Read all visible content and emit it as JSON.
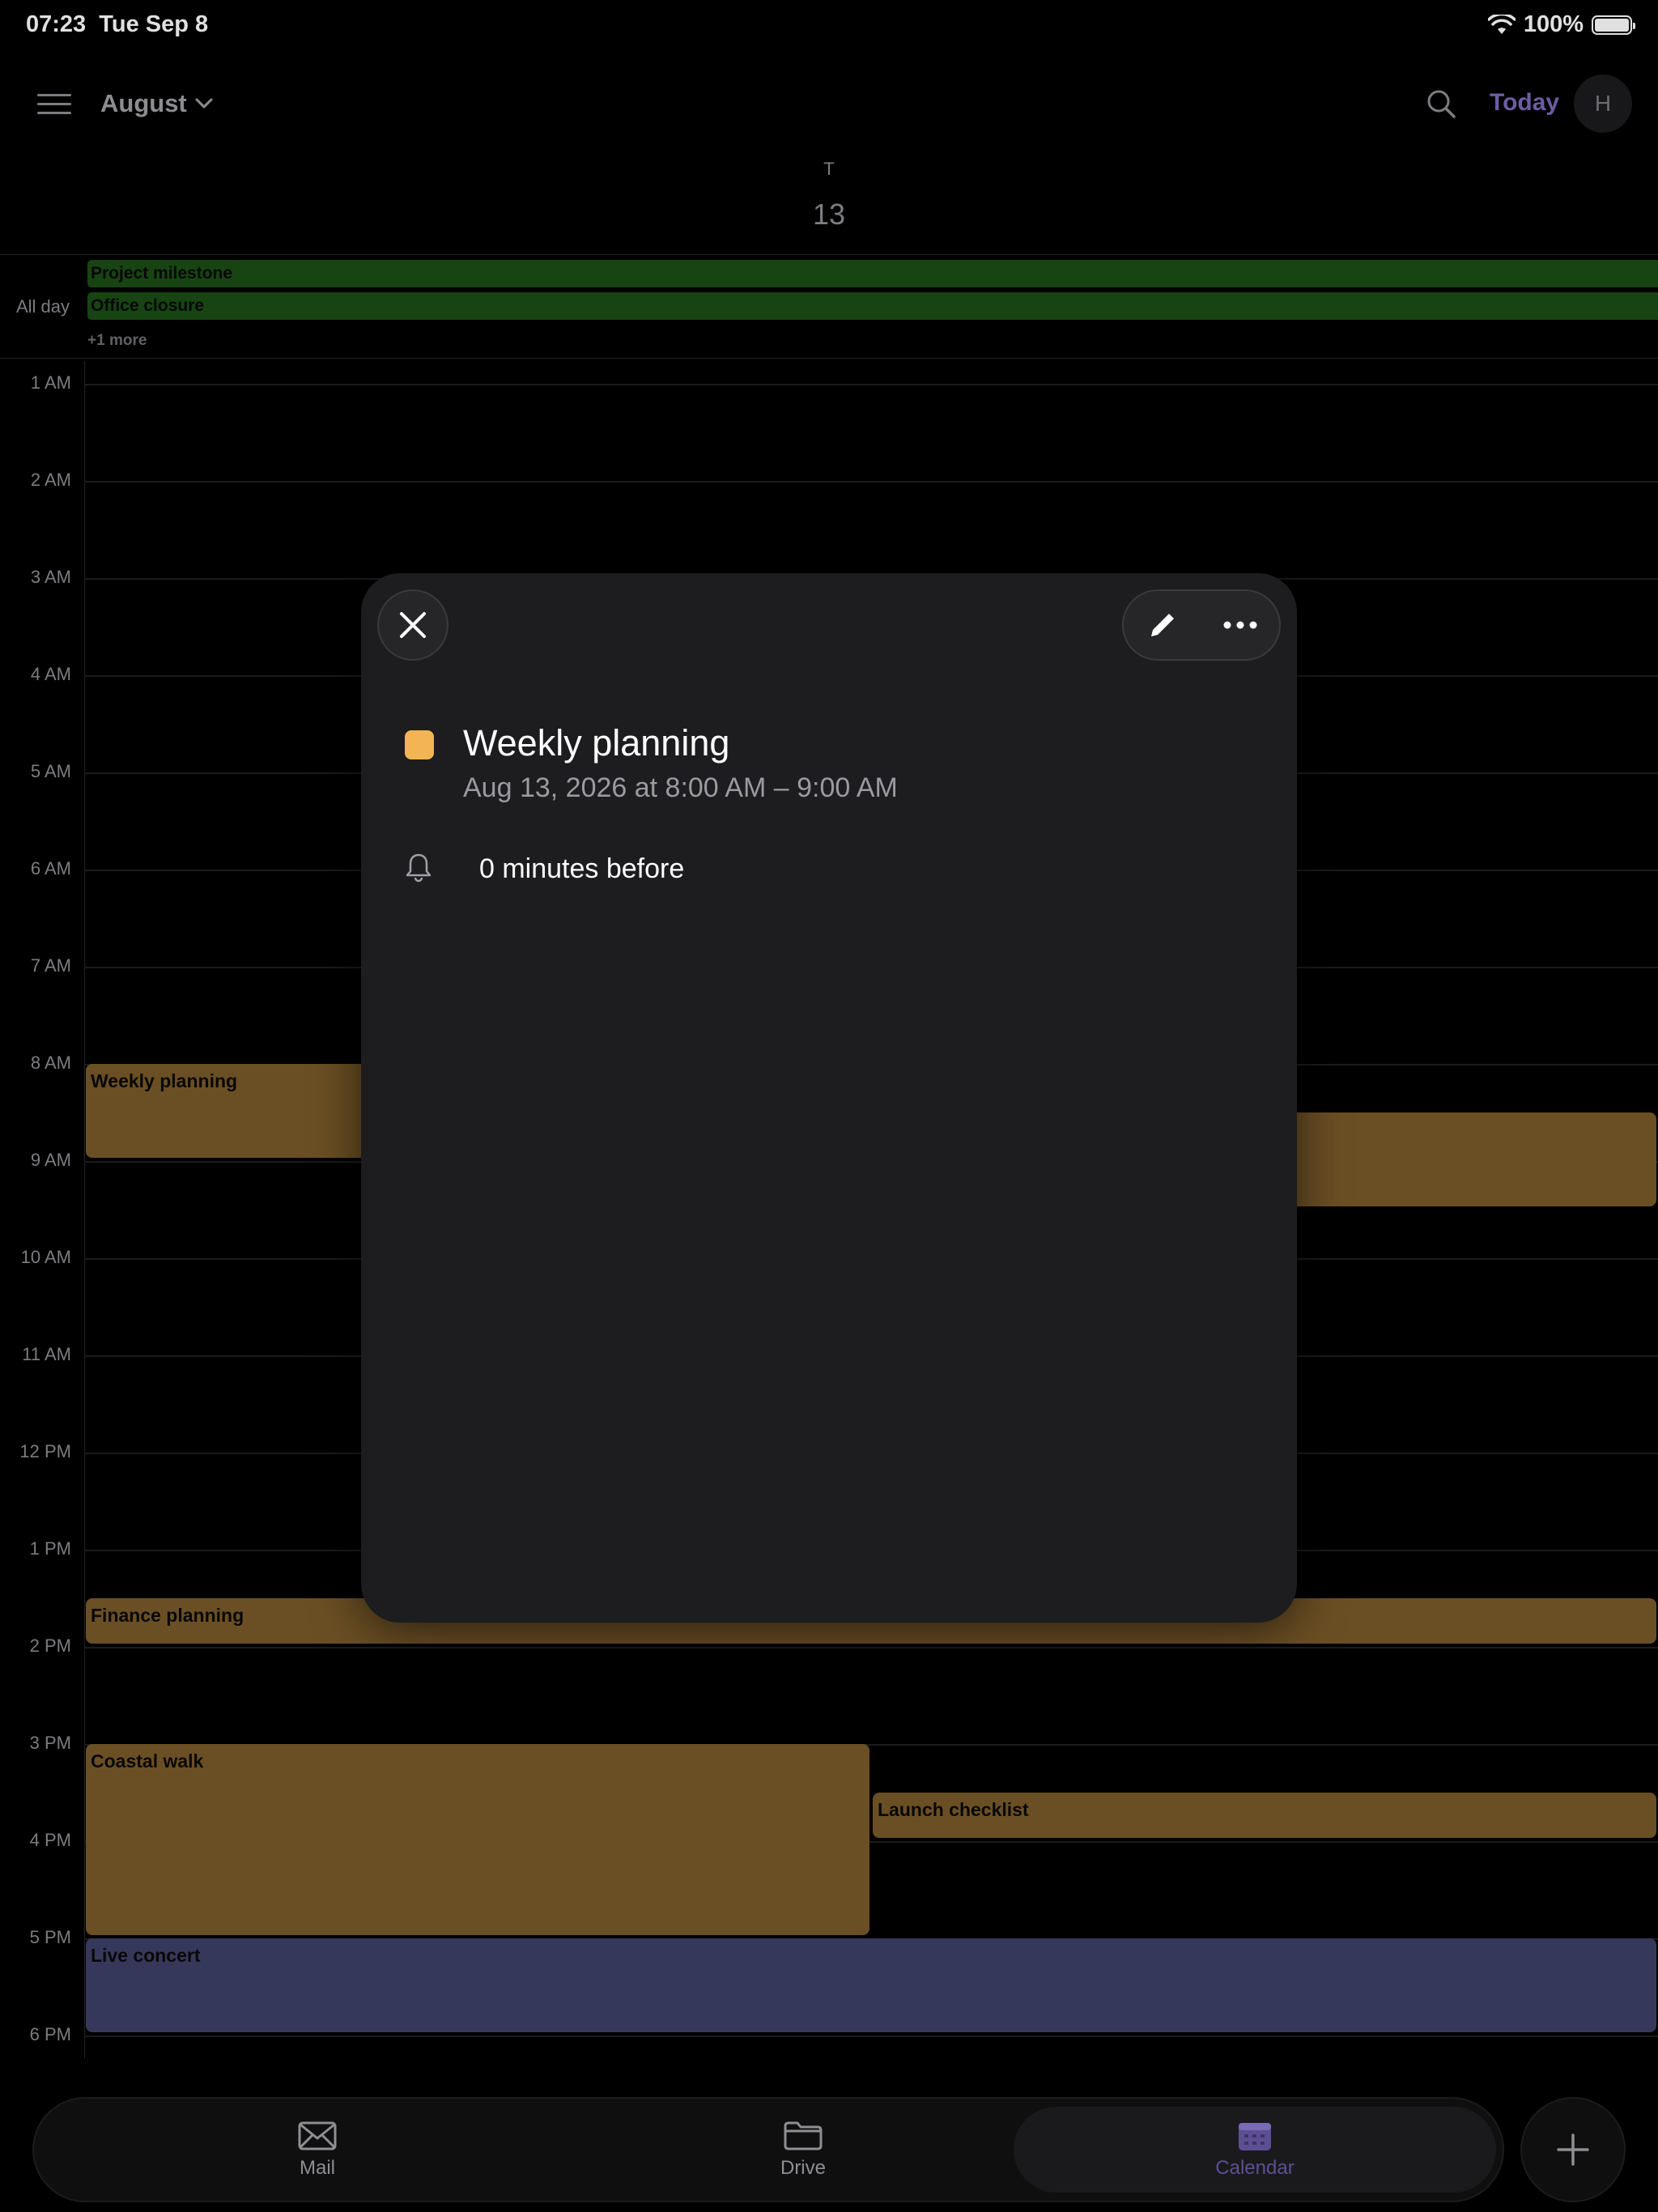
{
  "status": {
    "time": "07:23",
    "date": "Tue Sep 8",
    "battery": "100%",
    "battery_level": 1.0
  },
  "header": {
    "month": "August",
    "today": "Today",
    "avatar_initial": "H"
  },
  "day": {
    "letter": "T",
    "number": "13"
  },
  "allday": {
    "label": "All day",
    "events": [
      "Project milestone",
      "Office closure"
    ],
    "more": "+1 more"
  },
  "time_labels": [
    "1 AM",
    "2 AM",
    "3 AM",
    "4 AM",
    "5 AM",
    "6 AM",
    "7 AM",
    "8 AM",
    "9 AM",
    "10 AM",
    "11 AM",
    "12 PM",
    "1 PM",
    "2 PM",
    "3 PM",
    "4 PM",
    "5 PM",
    "6 PM"
  ],
  "events": {
    "weekly_planning": "Weekly planning",
    "finance_planning": "Finance planning",
    "coastal_walk": "Coastal walk",
    "launch_checklist": "Launch checklist",
    "live_concert": "Live concert"
  },
  "modal": {
    "title": "Weekly planning",
    "datetime": "Aug 13, 2026 at 8:00 AM – 9:00 AM",
    "reminder": "0 minutes before",
    "color": "#f3b453"
  },
  "tabs": {
    "mail": "Mail",
    "drive": "Drive",
    "calendar": "Calendar"
  },
  "colors": {
    "accent": "#7c6ab8",
    "event_orange": "#7a5a29",
    "event_blue": "#3e4068",
    "allday_green": "#1c4d16"
  }
}
